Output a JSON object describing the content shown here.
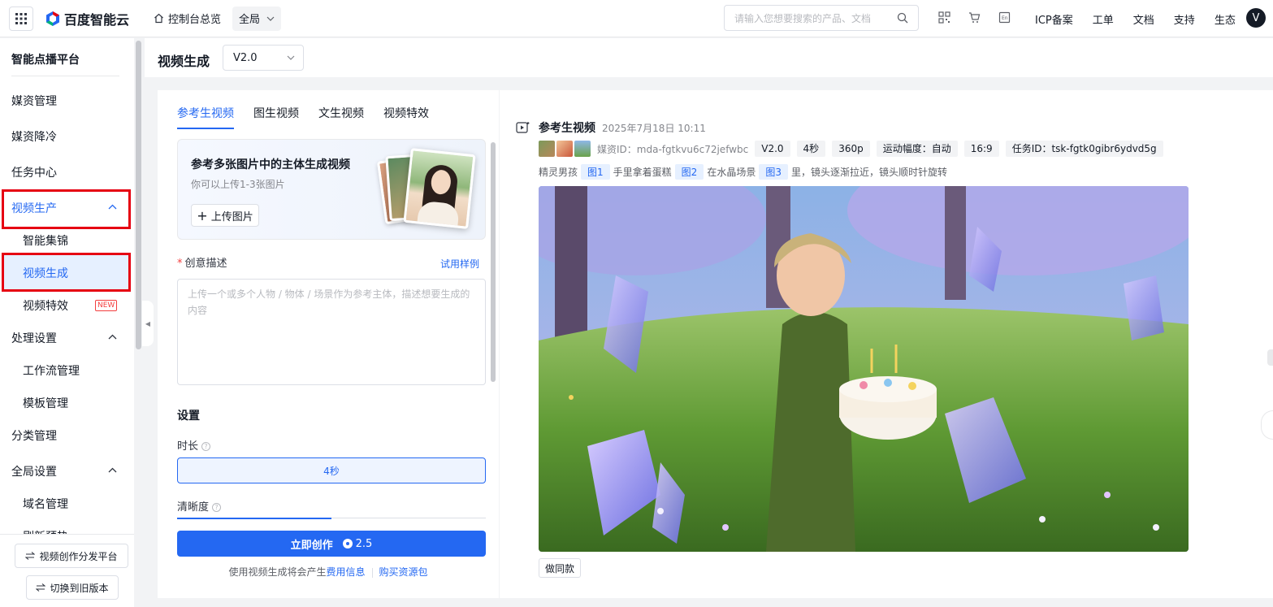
{
  "topbar": {
    "brand": "百度智能云",
    "home": "控制台总览",
    "region": "全局",
    "search_placeholder": "请输入您想要搜索的产品、文档",
    "icons": [
      "qrcode-icon",
      "cart-icon",
      "language-icon"
    ],
    "links": [
      "ICP备案",
      "工单",
      "文档",
      "支持",
      "生态"
    ],
    "avatar": "V"
  },
  "sidebar": {
    "title": "智能点播平台",
    "items": {
      "media": "媒资管理",
      "cold": "媒资降冷",
      "tasks": "任务中心",
      "video_prod": "视频生产",
      "highlights": "智能集锦",
      "video_gen": "视频生成",
      "video_fx": "视频特效",
      "processing": "处理设置",
      "workflow": "工作流管理",
      "template": "模板管理",
      "category": "分类管理",
      "global": "全局设置",
      "domain": "域名管理",
      "cut": "刷新预热"
    },
    "new_badge": "NEW",
    "bottom": {
      "platform_btn": "视频创作分发平台",
      "old_btn": "切换到旧版本"
    }
  },
  "header": {
    "title": "视频生成",
    "version": "V2.0"
  },
  "left_panel": {
    "tabs": [
      "参考生视频",
      "图生视频",
      "文生视频",
      "视频特效"
    ],
    "active_tab": 0,
    "banner": {
      "title": "参考多张图片中的主体生成视频",
      "subtitle": "你可以上传1-3张图片",
      "upload": "上传图片"
    },
    "desc_label": "创意描述",
    "req_mark": "*",
    "try_example": "试用样例",
    "desc_placeholder": "上传一个或多个人物 / 物体 / 场景作为参考主体，描述想要生成的内容",
    "settings_title": "设置",
    "duration_label": "时长",
    "duration_value": "4秒",
    "clarity_label": "清晰度",
    "help_mark": "?",
    "create_btn": "立即创作",
    "cost": "2.5",
    "fee_note": "使用视频生成将会产生",
    "fee_link": "费用信息",
    "buy_link": "购买资源包"
  },
  "task": {
    "title": "参考生视频",
    "time": "2025年7月18日 10:11",
    "media_label": "媒资ID：mda-fgtkvu6c72jefwbc",
    "chips": [
      "V2.0",
      "4秒",
      "360p",
      "运动幅度：自动",
      "16:9",
      "任务ID：tsk-fgtk0gibr6ydvd5g"
    ],
    "prompt": {
      "p1": "精灵男孩",
      "t1": "图1",
      "p2": "手里拿着蛋糕",
      "t2": "图2",
      "p3": "在水晶场景",
      "t3": "图3",
      "p4": "里，镜头逐渐拉近，镜头顺时针旋转"
    },
    "same_btn": "做同款"
  }
}
